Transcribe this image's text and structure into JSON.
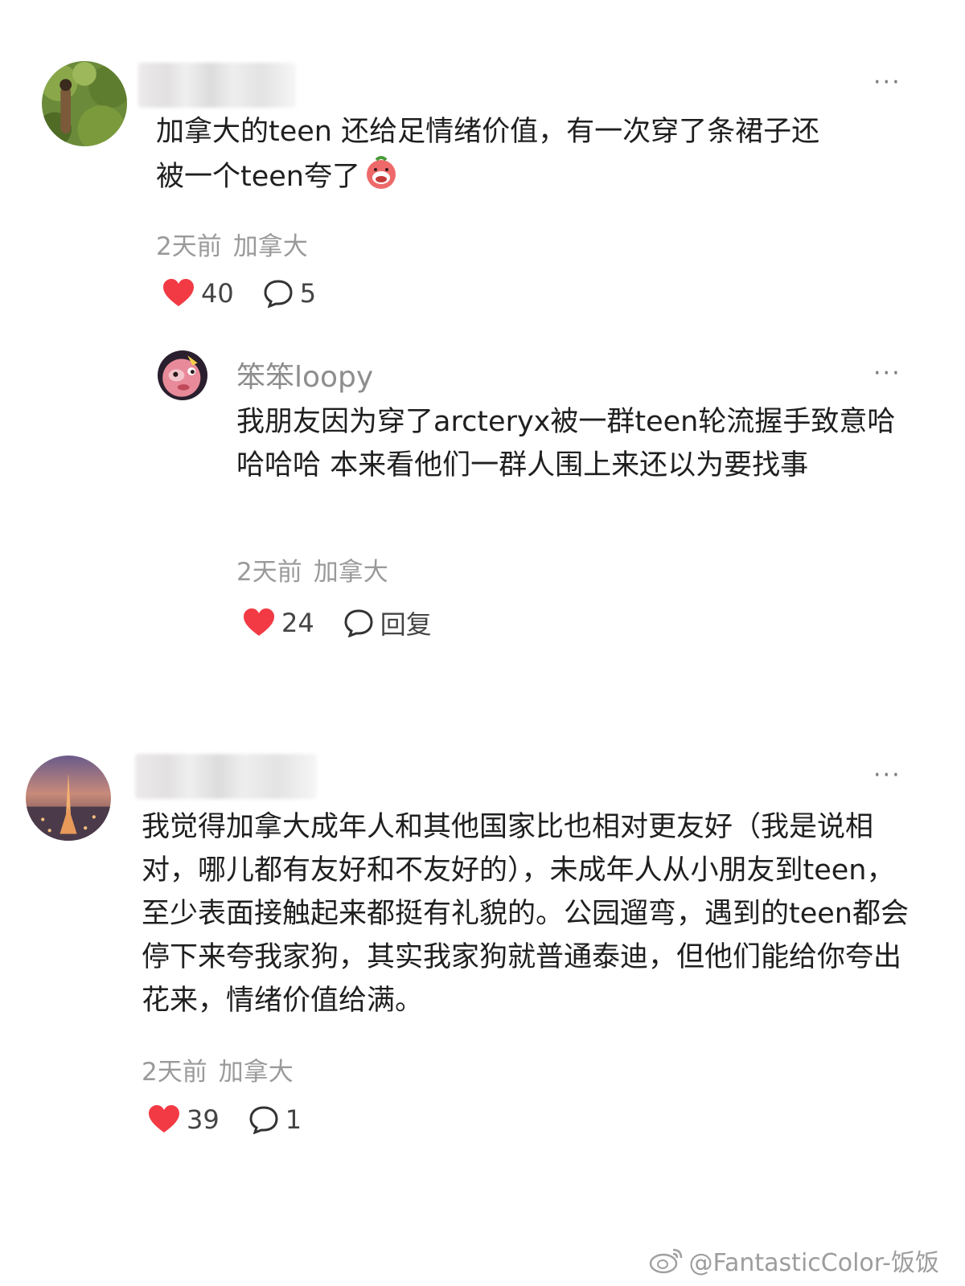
{
  "comments": [
    {
      "text_line1": "加拿大的teen 还给足情绪价值，有一次穿了条裙子还",
      "text_line2": "被一个teen夸了",
      "time": "2天前",
      "location": "加拿大",
      "likes": "40",
      "replies": "5"
    },
    {
      "author": "笨笨loopy",
      "text": "我朋友因为穿了arcteryx被一群teen轮流握手致意哈哈哈哈 本来看他们一群人围上来还以为要找事",
      "time": "2天前",
      "location": "加拿大",
      "likes": "24",
      "reply_label": "回复"
    },
    {
      "text": "我觉得加拿大成年人和其他国家比也相对更友好（我是说相对，哪儿都有友好和不友好的），未成年人从小朋友到teen，至少表面接触起来都挺有礼貌的。公园遛弯，遇到的teen都会停下来夸我家狗，其实我家狗就普通泰迪，但他们能给你夸出花来，情绪价值给满。",
      "time": "2天前",
      "location": "加拿大",
      "likes": "39",
      "replies": "1"
    }
  ],
  "more_label": "···",
  "watermark": "@FantasticColor-饭饭",
  "colors": {
    "heart": "#f23a45",
    "meta": "#9a9a9a",
    "name": "#8d8d8d"
  }
}
